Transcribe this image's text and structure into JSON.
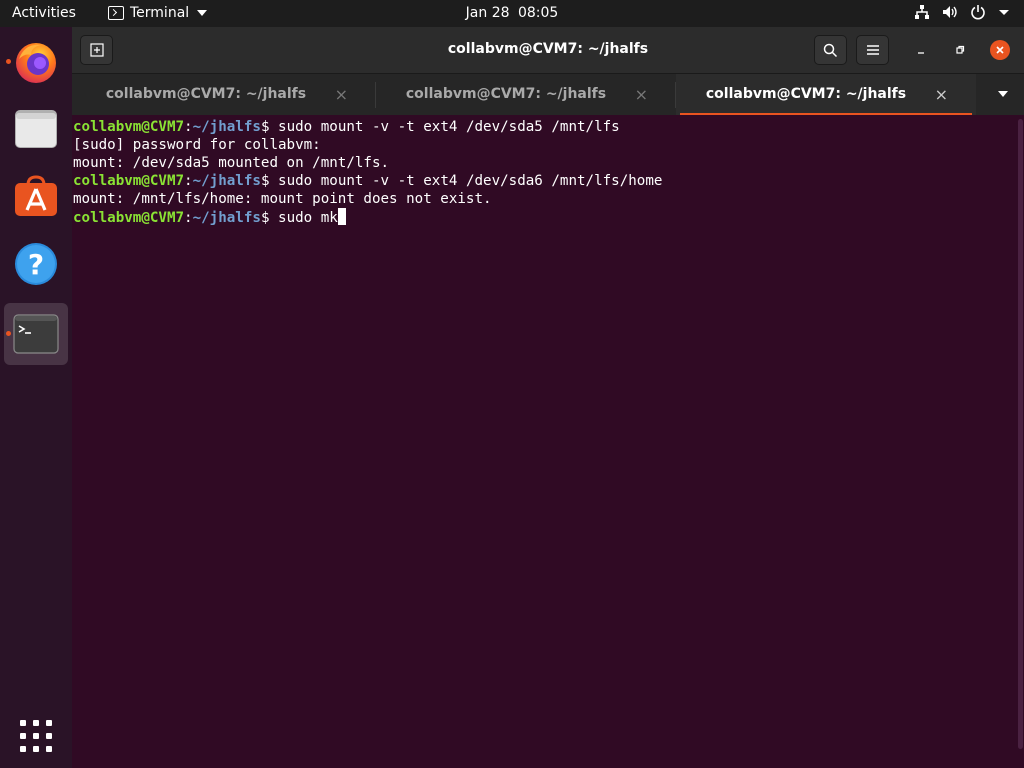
{
  "topbar": {
    "activities": "Activities",
    "app_menu": "Terminal",
    "date": "Jan 28",
    "time": "08:05",
    "tray_icons": [
      "network-icon",
      "volume-icon",
      "power-icon",
      "chevron-down-icon"
    ]
  },
  "dock": {
    "items": [
      {
        "name": "Firefox",
        "icon": "firefox-icon",
        "running": true
      },
      {
        "name": "Files",
        "icon": "files-icon",
        "running": false
      },
      {
        "name": "Ubuntu Software",
        "icon": "software-icon",
        "running": false
      },
      {
        "name": "Help",
        "icon": "help-icon",
        "running": false
      },
      {
        "name": "Terminal",
        "icon": "terminal-icon",
        "running": true,
        "active": true
      }
    ],
    "show_apps_icon": "app-grid-icon"
  },
  "window": {
    "title": "collabvm@CVM7: ~/jhalfs",
    "tabs": [
      {
        "label": "collabvm@CVM7: ~/jhalfs",
        "active": false
      },
      {
        "label": "collabvm@CVM7: ~/jhalfs",
        "active": false
      },
      {
        "label": "collabvm@CVM7: ~/jhalfs",
        "active": true
      }
    ],
    "close_glyph": "×"
  },
  "terminal": {
    "prompt_user": "collabvm@CVM7",
    "prompt_colon": ":",
    "prompt_path": "~/jhalfs",
    "prompt_dollar": "$ ",
    "lines": [
      {
        "type": "prompt",
        "cmd": "sudo mount -v -t ext4 /dev/sda5 /mnt/lfs"
      },
      {
        "type": "output",
        "text": "[sudo] password for collabvm:"
      },
      {
        "type": "output",
        "text": "mount: /dev/sda5 mounted on /mnt/lfs."
      },
      {
        "type": "prompt",
        "cmd": "sudo mount -v -t ext4 /dev/sda6 /mnt/lfs/home"
      },
      {
        "type": "output",
        "text": "mount: /mnt/lfs/home: mount point does not exist."
      },
      {
        "type": "prompt",
        "cmd": "sudo mk"
      }
    ]
  },
  "colors": {
    "terminal_bg": "#300a24",
    "prompt_user": "#8ae234",
    "prompt_path": "#729fcf",
    "accent": "#e95420"
  }
}
